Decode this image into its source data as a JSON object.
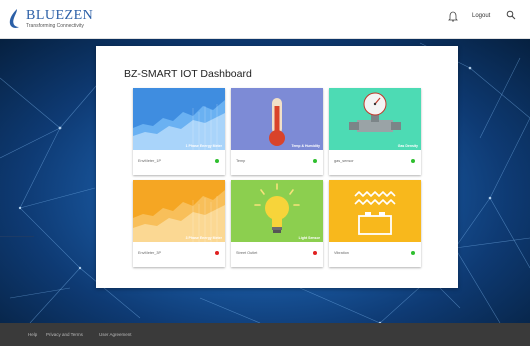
{
  "header": {
    "logo_name": "BLUEZEN",
    "logo_tagline": "Transforming Connectivity",
    "logout_label": "Logout"
  },
  "icons": {
    "bell": "bell-icon",
    "search": "search-icon"
  },
  "dashboard": {
    "title": "BZ-SMART IOT Dashboard",
    "cards": [
      {
        "caption": "1 Phase Energy Meter",
        "name": "EnvMeter_1P",
        "status_color": "#2fbf2f"
      },
      {
        "caption": "Temp & Humidity",
        "name": "Temp",
        "status_color": "#2fbf2f"
      },
      {
        "caption": "Gas Density",
        "name": "gas_sensor",
        "status_color": "#2fbf2f"
      },
      {
        "caption": "3 Phase Energy Meter",
        "name": "EnvMeter_3P",
        "status_color": "#e02020"
      },
      {
        "caption": "Light Sensor",
        "name": "Street Outlet",
        "status_color": "#e02020"
      },
      {
        "caption": "",
        "name": "Vibration",
        "status_color": "#2fbf2f"
      }
    ]
  },
  "footer": {
    "links": [
      "Help",
      "Privacy and Terms",
      "User Agreement"
    ]
  },
  "colors": {
    "brand": "#2b5fa7",
    "status_on": "#2fbf2f",
    "status_off": "#e02020",
    "footer_bg": "#3a3a3a"
  }
}
